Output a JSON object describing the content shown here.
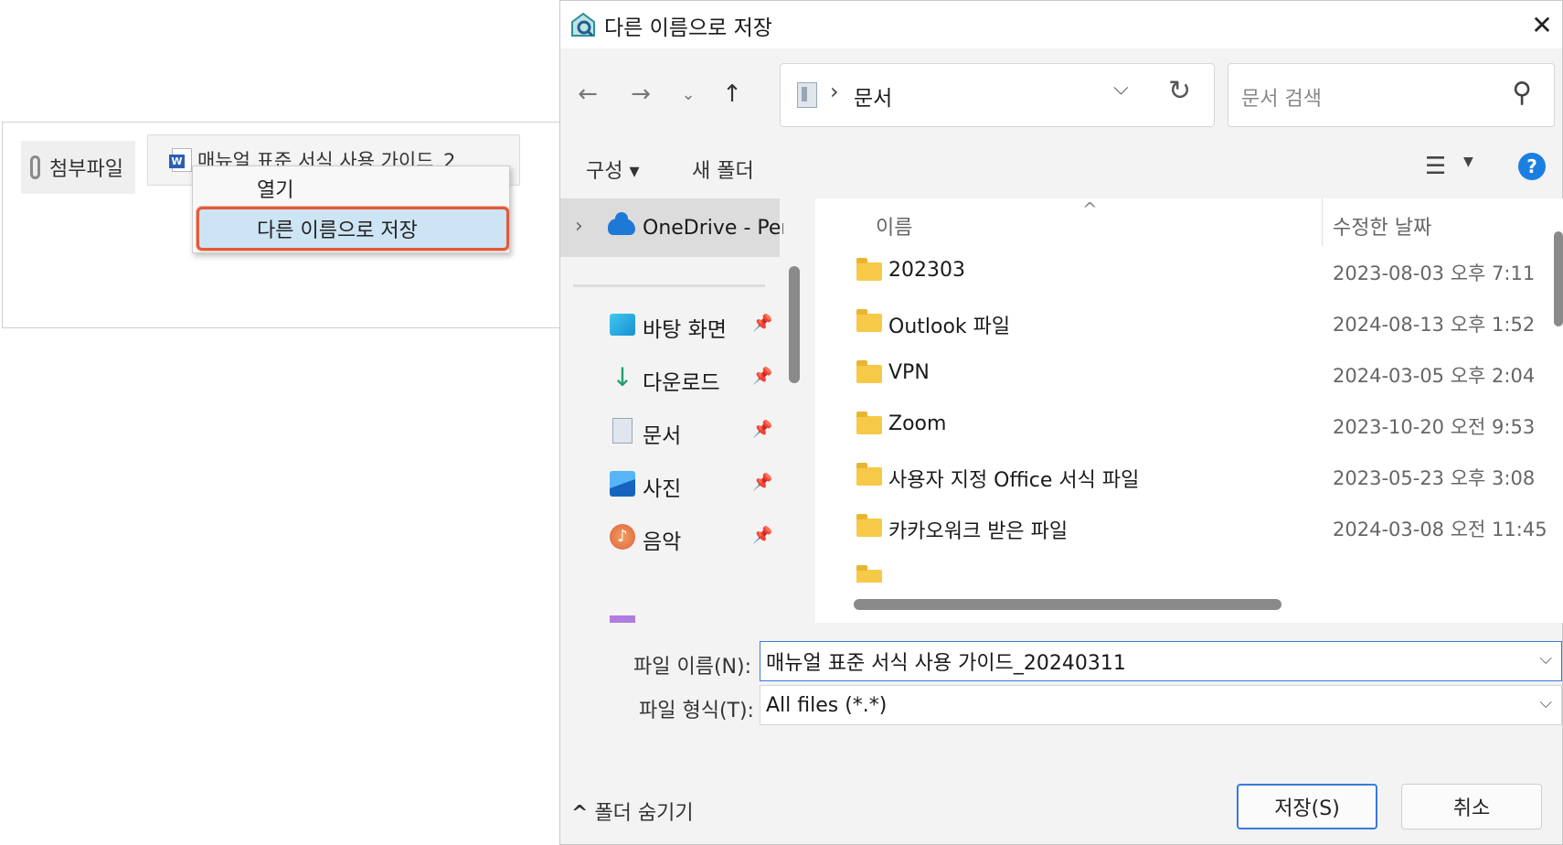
{
  "mail": {
    "attach_label": "첨부파일",
    "attach_filename": "매뉴얼 표준 서식 사용 가이드_2",
    "context_menu": {
      "open": "열기",
      "save_as": "다른 이름으로 저장"
    }
  },
  "dialog": {
    "title": "다른 이름으로 저장",
    "close": "✕",
    "address": {
      "current": "문서"
    },
    "search": {
      "placeholder": "문서 검색"
    },
    "toolbar": {
      "organize": "구성 ▾",
      "new_folder": "새 폴더",
      "help": "?"
    },
    "nav": {
      "onedrive": "OneDrive - Pers",
      "items": [
        {
          "label": "바탕 화면",
          "icon": "desktop-icon"
        },
        {
          "label": "다운로드",
          "icon": "download-icon"
        },
        {
          "label": "문서",
          "icon": "documents-icon"
        },
        {
          "label": "사진",
          "icon": "pictures-icon"
        },
        {
          "label": "음악",
          "icon": "music-icon"
        }
      ]
    },
    "columns": {
      "name": "이름",
      "modified": "수정한 날짜"
    },
    "files": [
      {
        "name": "202303",
        "modified": "2023-08-03 오후 7:11"
      },
      {
        "name": "Outlook 파일",
        "modified": "2024-08-13 오후 1:52"
      },
      {
        "name": "VPN",
        "modified": "2024-03-05 오후 2:04"
      },
      {
        "name": "Zoom",
        "modified": "2023-10-20 오전 9:53"
      },
      {
        "name": "사용자 지정 Office 서식 파일",
        "modified": "2023-05-23 오후 3:08"
      },
      {
        "name": "카카오워크 받은 파일",
        "modified": "2024-03-08 오전 11:45"
      }
    ],
    "form": {
      "filename_label": "파일 이름(N):",
      "filename_value": "매뉴얼 표준 서식 사용 가이드_20240311",
      "filetype_label": "파일 형식(T):",
      "filetype_value": "All files (*.*)"
    },
    "hide_folders": "폴더 숨기기",
    "save": "저장(S)",
    "cancel": "취소"
  },
  "colors": {
    "accent": "#1a7fe0",
    "highlight": "#cde4f4",
    "highlight_border": "#e35a3a",
    "folder": "#f7c948"
  }
}
